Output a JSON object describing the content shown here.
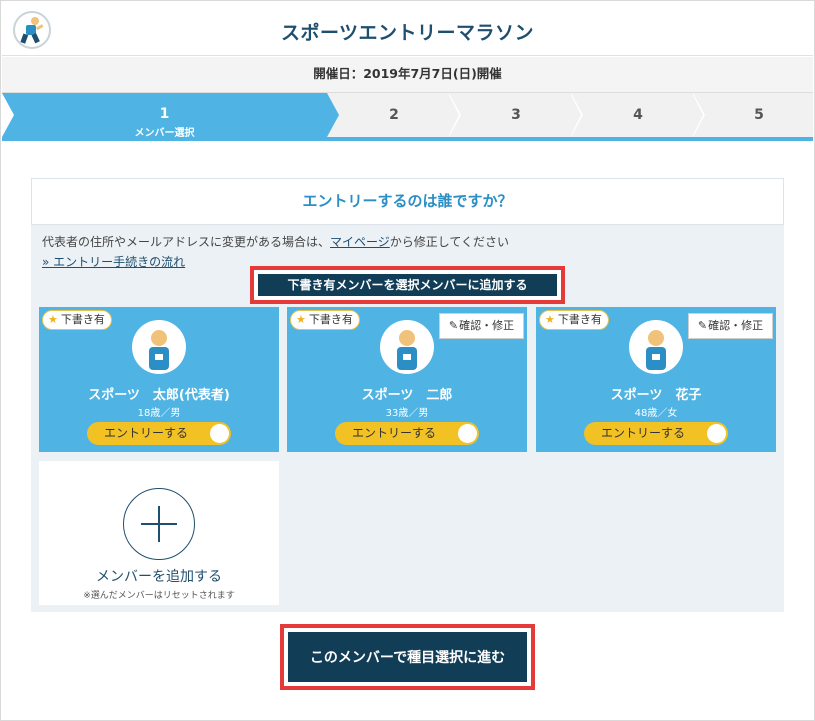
{
  "header": {
    "title": "スポーツエントリーマラソン"
  },
  "event": {
    "date_text": "開催日：2019年7月7日(日)開催"
  },
  "steps": [
    {
      "num": "1",
      "label": "メンバー選択",
      "active": true
    },
    {
      "num": "2"
    },
    {
      "num": "3"
    },
    {
      "num": "4"
    },
    {
      "num": "5"
    }
  ],
  "section": {
    "question": "エントリーするのは誰ですか？",
    "note_prefix": "代表者の住所やメールアドレスに変更がある場合は、",
    "note_link": "マイページ",
    "note_suffix": "から修正してください",
    "flow_link": "» エントリー手続きの流れ",
    "draft_button": "下書き有メンバーを選択メンバーに追加する"
  },
  "members": [
    {
      "badge": "下書き有",
      "name": "スポーツ　太郎(代表者)",
      "age_sex": "18歳／男",
      "toggle_label": "エントリーする"
    },
    {
      "badge": "下書き有",
      "edit_label": "確認・修正",
      "name": "スポーツ　二郎",
      "age_sex": "33歳／男",
      "toggle_label": "エントリーする"
    },
    {
      "badge": "下書き有",
      "edit_label": "確認・修正",
      "name": "スポーツ　花子",
      "age_sex": "48歳／女",
      "toggle_label": "エントリーする"
    }
  ],
  "add_member": {
    "label": "メンバーを追加する",
    "note": "※選んだメンバーはリセットされます"
  },
  "next_button": "このメンバーで種目選択に進む",
  "colors": {
    "accent": "#4fb3e3",
    "navy": "#123d56",
    "highlight": "#e53a3a",
    "toggle": "#f2c225"
  }
}
